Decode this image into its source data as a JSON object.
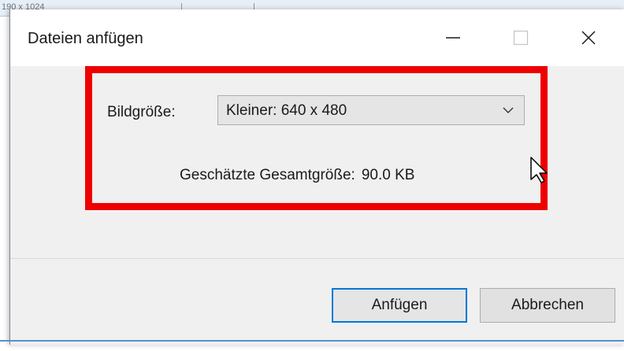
{
  "background_window": {
    "partial_text": "190 x 1024"
  },
  "dialog": {
    "title": "Dateien anfügen",
    "controls": {
      "minimize_icon": "minimize-icon",
      "maximize_icon": "maximize-icon",
      "close_icon": "close-icon"
    },
    "image_size": {
      "label": "Bildgröße:",
      "selected": "Kleiner: 640 x 480"
    },
    "estimate": {
      "label": "Geschätzte Gesamtgröße:",
      "value": "90.0 KB"
    },
    "buttons": {
      "attach": "Anfügen",
      "cancel": "Abbrechen"
    }
  },
  "colors": {
    "highlight": "#ee0000",
    "default_button_border": "#0078d7"
  }
}
